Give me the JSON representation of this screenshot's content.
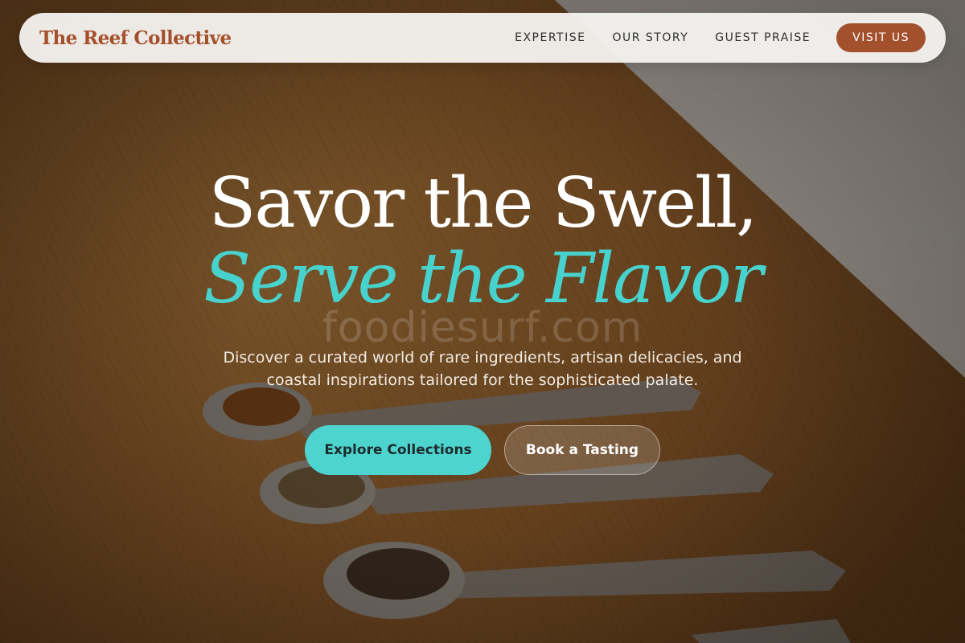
{
  "brand": {
    "name": "The Reef Collective"
  },
  "nav": {
    "links": [
      "EXPERTISE",
      "OUR STORY",
      "GUEST PRAISE"
    ],
    "cta_label": "VISIT US"
  },
  "hero": {
    "title_line1": "Savor the Swell,",
    "title_line2": "Serve the Flavor",
    "watermark": "foodiesurf.com",
    "subtitle": "Discover a curated world of rare ingredients, artisan delicacies, and coastal inspirations tailored for the sophisticated palate.",
    "primary_cta": "Explore Collections",
    "secondary_cta": "Book a Tasting"
  },
  "colors": {
    "accent_teal": "#4dd4cf",
    "brand_rust": "#a3512d"
  },
  "background": {
    "scene": "spice-spoons-on-wood"
  }
}
